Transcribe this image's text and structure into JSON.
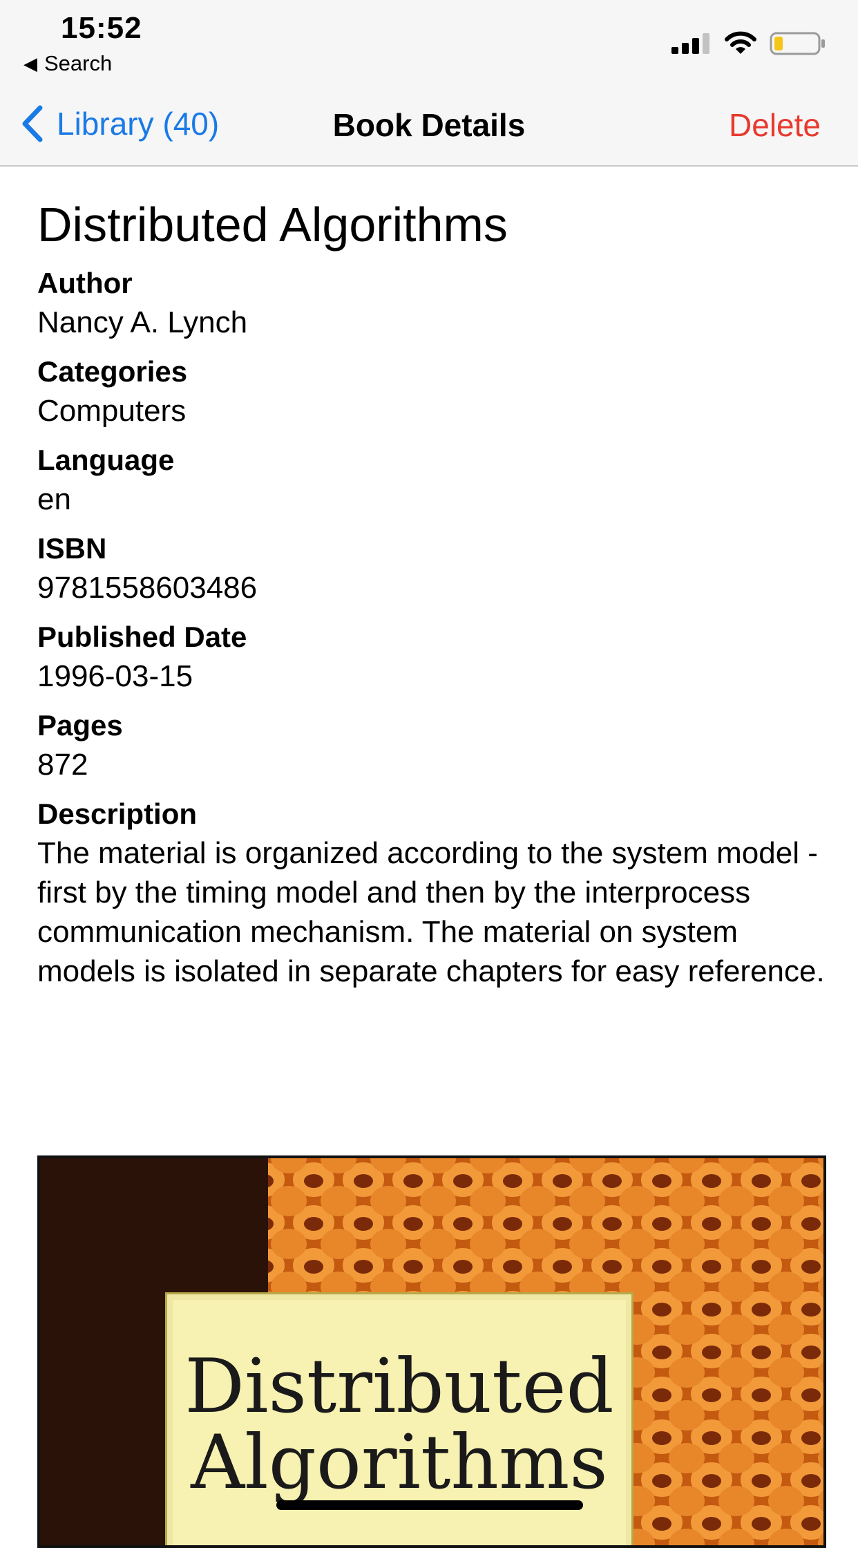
{
  "status_bar": {
    "time": "15:52",
    "back_label": "Search",
    "icons": [
      "cellular-signal-icon",
      "wifi-icon",
      "battery-icon"
    ],
    "battery_level": 0.2
  },
  "nav": {
    "back_label": "Library (40)",
    "title": "Book Details",
    "action_label": "Delete",
    "colors": {
      "link": "#1a7ae6",
      "destructive": "#e8392e",
      "bar_bg": "#f6f6f6"
    }
  },
  "book": {
    "title": "Distributed Algorithms",
    "fields": [
      {
        "label": "Author",
        "value": "Nancy A. Lynch"
      },
      {
        "label": "Categories",
        "value": "Computers"
      },
      {
        "label": "Language",
        "value": "en"
      },
      {
        "label": "ISBN",
        "value": "9781558603486"
      },
      {
        "label": "Published Date",
        "value": "1996-03-15"
      },
      {
        "label": "Pages",
        "value": "872"
      }
    ],
    "description_label": "Description",
    "description": "The material is organized according to the system model - first by the timing model and then by the interprocess communication mechanism. The material on system models is isolated in separate chapters for easy reference.",
    "cover": {
      "title_line1": "Distributed",
      "title_line2": "Algorithms",
      "colors": {
        "spine": "#2a1208",
        "pattern": "#e07a1c",
        "label": "#f7f1b2"
      }
    }
  }
}
